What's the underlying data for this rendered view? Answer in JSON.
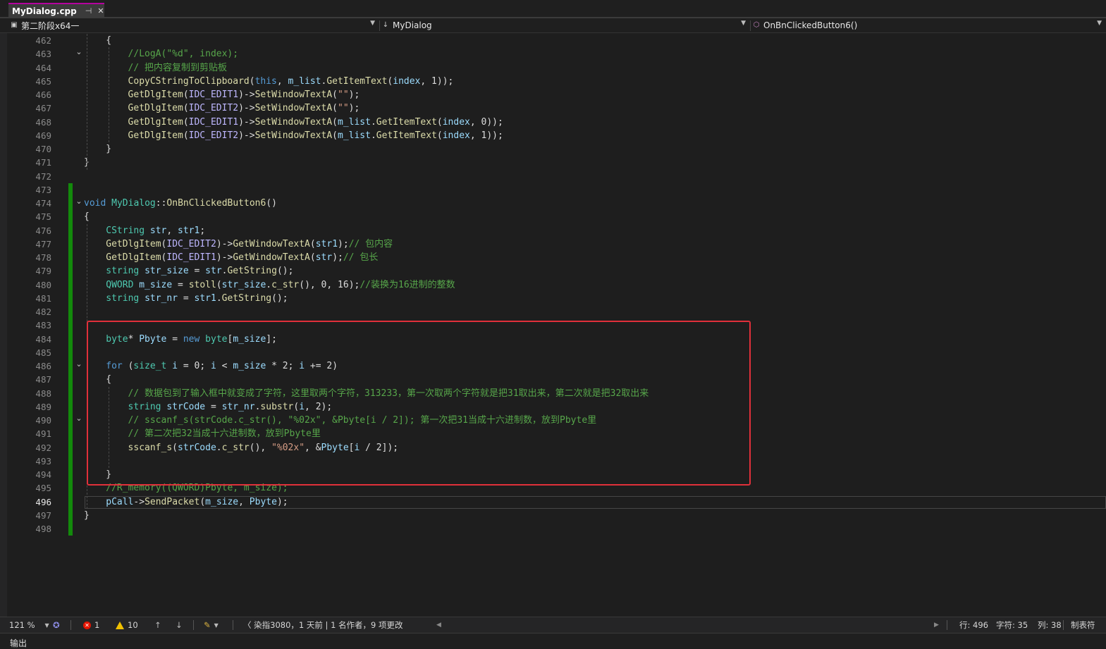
{
  "tab": {
    "title": "MyDialog.cpp",
    "pin": "⊣",
    "close": "✕"
  },
  "nav": {
    "project": "第二阶段x64一",
    "class_arrow": "↓",
    "class": "MyDialog",
    "member": "OnBnClickedButton6()"
  },
  "lines": [
    {
      "n": "462",
      "code": "{"
    },
    {
      "n": "463",
      "code": "//LogA(\"%d\", index);"
    },
    {
      "n": "464",
      "code": "// 把内容复制到剪贴板"
    },
    {
      "n": "465",
      "code": "CopyCStringToClipboard(this, m_list.GetItemText(index, 1));"
    },
    {
      "n": "466",
      "code": "GetDlgItem(IDC_EDIT1)->SetWindowTextA(\"\");"
    },
    {
      "n": "467",
      "code": "GetDlgItem(IDC_EDIT2)->SetWindowTextA(\"\");"
    },
    {
      "n": "468",
      "code": "GetDlgItem(IDC_EDIT1)->SetWindowTextA(m_list.GetItemText(index, 0));"
    },
    {
      "n": "469",
      "code": "GetDlgItem(IDC_EDIT2)->SetWindowTextA(m_list.GetItemText(index, 1));"
    },
    {
      "n": "470",
      "code": "}"
    },
    {
      "n": "471",
      "code": "}"
    },
    {
      "n": "472",
      "code": ""
    },
    {
      "n": "473",
      "code": ""
    },
    {
      "n": "474",
      "code": "void MyDialog::OnBnClickedButton6()"
    },
    {
      "n": "475",
      "code": "{"
    },
    {
      "n": "476",
      "code": "CString str, str1;"
    },
    {
      "n": "477",
      "code": "GetDlgItem(IDC_EDIT2)->GetWindowTextA(str1);// 包内容"
    },
    {
      "n": "478",
      "code": "GetDlgItem(IDC_EDIT1)->GetWindowTextA(str);// 包长"
    },
    {
      "n": "479",
      "code": "string str_size = str.GetString();"
    },
    {
      "n": "480",
      "code": "QWORD m_size = stoll(str_size.c_str(), 0, 16);//装换为16进制的整数"
    },
    {
      "n": "481",
      "code": "string str_nr = str1.GetString();"
    },
    {
      "n": "482",
      "code": ""
    },
    {
      "n": "483",
      "code": ""
    },
    {
      "n": "484",
      "code": "byte* Pbyte = new byte[m_size];"
    },
    {
      "n": "485",
      "code": ""
    },
    {
      "n": "486",
      "code": "for (size_t i = 0; i < m_size * 2; i += 2)"
    },
    {
      "n": "487",
      "code": "{"
    },
    {
      "n": "488",
      "code": "// 数据包到了输入框中就变成了字符，这里取两个字符，313233，第一次取两个字符就是把31取出来，第二次就是把32取出来"
    },
    {
      "n": "489",
      "code": "string strCode = str_nr.substr(i, 2);"
    },
    {
      "n": "490",
      "code": "// sscanf_s(strCode.c_str(), \"%02x\", &Pbyte[i / 2]); 第一次把31当成十六进制数，放到Pbyte里"
    },
    {
      "n": "491",
      "code": "// 第二次把32当成十六进制数，放到Pbyte里"
    },
    {
      "n": "492",
      "code": "sscanf_s(strCode.c_str(), \"%02x\", &Pbyte[i / 2]);"
    },
    {
      "n": "493",
      "code": ""
    },
    {
      "n": "494",
      "code": "}"
    },
    {
      "n": "495",
      "code": "//R_memory((QWORD)Pbyte, m_size);"
    },
    {
      "n": "496",
      "code": "pCall->SendPacket(m_size, Pbyte);"
    },
    {
      "n": "497",
      "code": "}"
    },
    {
      "n": "498",
      "code": ""
    }
  ],
  "status": {
    "zoom": "121 %",
    "errors": "1",
    "warnings": "10",
    "git": "〈 染指3080，1 天前 | 1 名作者，9 项更改",
    "line": "行: 496",
    "char": "字符: 35",
    "col": "列: 38",
    "tabs": "制表符"
  },
  "output": {
    "title": "输出"
  },
  "colors": {
    "keyword": "#569cd6",
    "type": "#4ec9b0",
    "function": "#dcdcaa",
    "comment": "#57a64a",
    "string": "#d69d85",
    "macro": "#beb7ff",
    "variable": "#9cdcfe",
    "highlight_box": "#e0303a",
    "change_bar": "#138a0b"
  }
}
